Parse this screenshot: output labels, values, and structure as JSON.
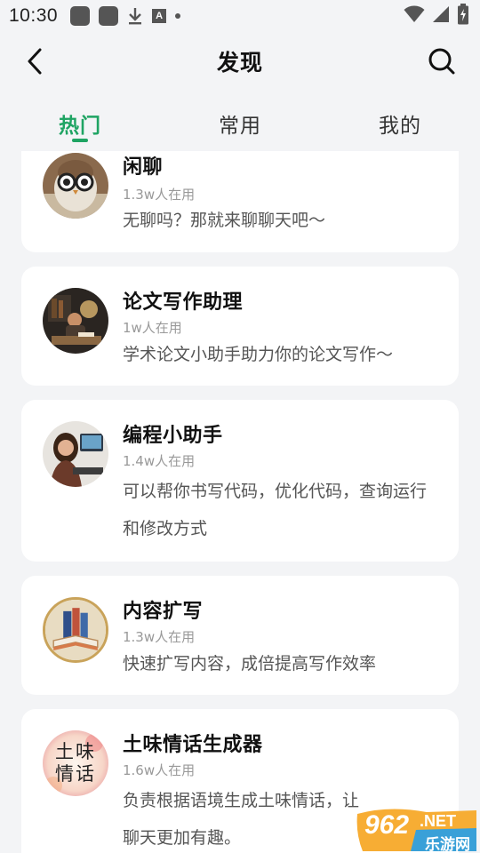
{
  "status_bar": {
    "time": "10:30"
  },
  "header": {
    "title": "发现"
  },
  "tabs": [
    {
      "label": "热门",
      "active": true
    },
    {
      "label": "常用",
      "active": false
    },
    {
      "label": "我的",
      "active": false
    }
  ],
  "items": [
    {
      "title": "闲聊",
      "users": "1.3w人在用",
      "description": "无聊吗？那就来聊聊天吧～",
      "avatar": "owl-with-glasses"
    },
    {
      "title": "论文写作助理",
      "users": "1w人在用",
      "description": "学术论文小助手助力你的论文写作～",
      "avatar": "person-studying-desk"
    },
    {
      "title": "编程小助手",
      "users": "1.4w人在用",
      "description": "可以帮你书写代码，优化代码，查询运行和修改方式",
      "avatar": "woman-at-computer"
    },
    {
      "title": "内容扩写",
      "users": "1.3w人在用",
      "description": "快速扩写内容，成倍提高写作效率",
      "avatar": "books-stack"
    },
    {
      "title": "土味情话生成器",
      "users": "1.6w人在用",
      "description": "负责根据语境生成土味情话，让聊天更加有趣。",
      "avatar": "flower-text",
      "avatar_text": "土味情话"
    }
  ],
  "watermark": {
    "number": "962",
    "suffix": ".NET",
    "text": "乐游网"
  },
  "colors": {
    "accent": "#1fa463",
    "background": "#f3f4f6",
    "card": "#ffffff"
  }
}
